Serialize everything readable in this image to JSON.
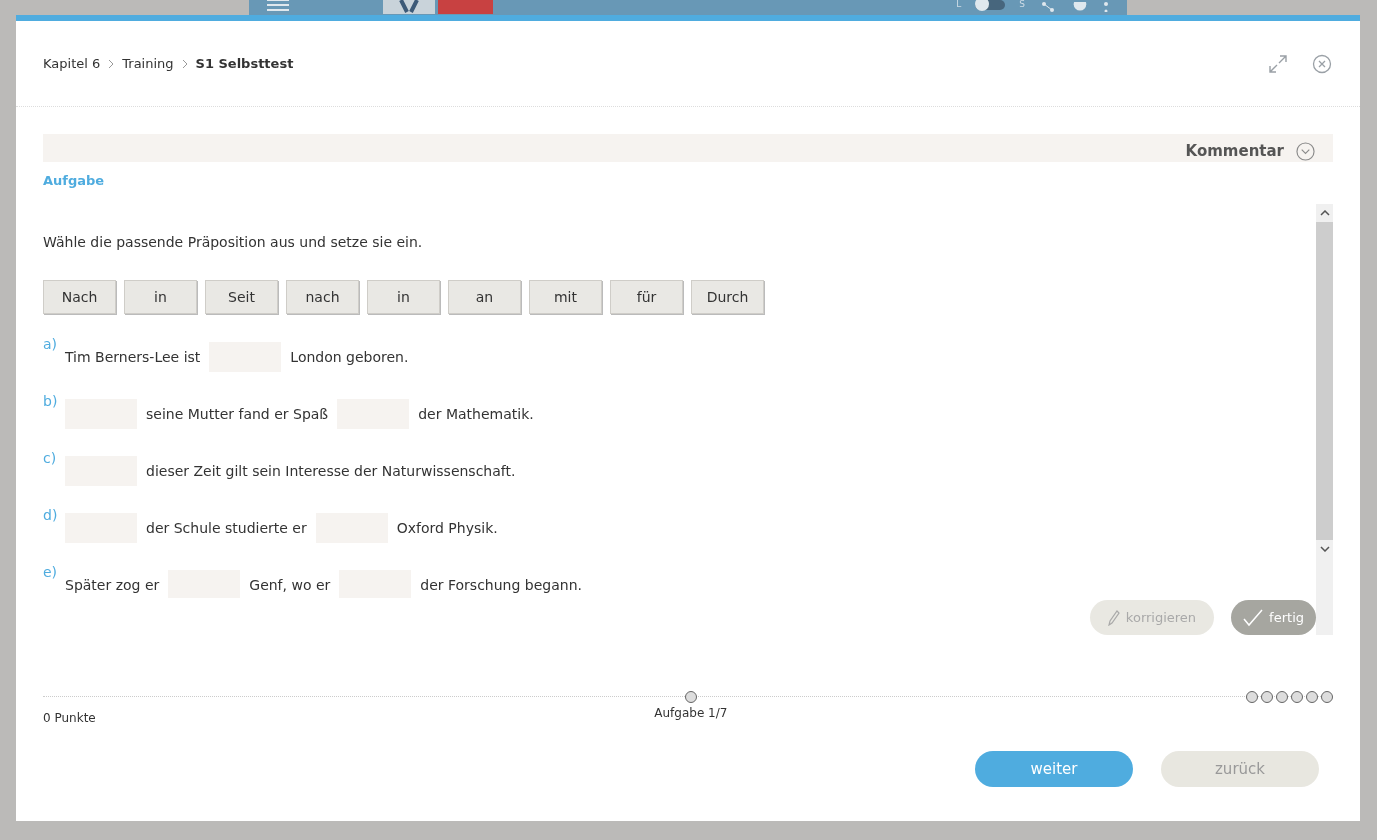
{
  "app_bar": {
    "toggle": {
      "left": "L",
      "right": "S",
      "on": false
    }
  },
  "breadcrumb": [
    {
      "label": "Kapitel 6",
      "current": false
    },
    {
      "label": "Training",
      "current": false
    },
    {
      "label": "S1 Selbsttest",
      "current": true
    }
  ],
  "comment": {
    "label": "Kommentar",
    "expanded": false
  },
  "section_label": "Aufgabe",
  "instruction": "Wähle die passende Präposition aus und setze sie ein.",
  "word_bank": [
    "Nach",
    "in",
    "Seit",
    "nach",
    "in",
    "an",
    "mit",
    "für",
    "Durch"
  ],
  "sentences": [
    {
      "letter": "a)",
      "parts": [
        {
          "kind": "text",
          "text": "Tim Berners-Lee ist"
        },
        {
          "kind": "gap"
        },
        {
          "kind": "text",
          "text": "London geboren."
        }
      ]
    },
    {
      "letter": "b)",
      "parts": [
        {
          "kind": "gap"
        },
        {
          "kind": "text",
          "text": "seine Mutter fand er Spaß"
        },
        {
          "kind": "gap"
        },
        {
          "kind": "text",
          "text": "der Mathematik."
        }
      ]
    },
    {
      "letter": "c)",
      "parts": [
        {
          "kind": "gap"
        },
        {
          "kind": "text",
          "text": "dieser Zeit gilt sein Interesse der Naturwissenschaft."
        }
      ]
    },
    {
      "letter": "d)",
      "parts": [
        {
          "kind": "gap"
        },
        {
          "kind": "text",
          "text": "der Schule studierte er"
        },
        {
          "kind": "gap"
        },
        {
          "kind": "text",
          "text": "Oxford Physik."
        }
      ]
    },
    {
      "letter": "e)",
      "parts": [
        {
          "kind": "text",
          "text": "Später zog er"
        },
        {
          "kind": "gap"
        },
        {
          "kind": "text",
          "text": "Genf, wo er"
        },
        {
          "kind": "gap"
        },
        {
          "kind": "text",
          "text": "der Forschung begann."
        }
      ]
    }
  ],
  "actions": [
    {
      "label": "korrigieren",
      "kind": "correct",
      "disabled": true
    },
    {
      "label": "fertig",
      "kind": "done",
      "disabled": false
    }
  ],
  "score": "0 Punkte",
  "progress": {
    "label": "Aufgabe 1/7"
  },
  "nav": [
    {
      "label": "weiter",
      "primary": true
    },
    {
      "label": "zurück",
      "primary": false
    }
  ]
}
